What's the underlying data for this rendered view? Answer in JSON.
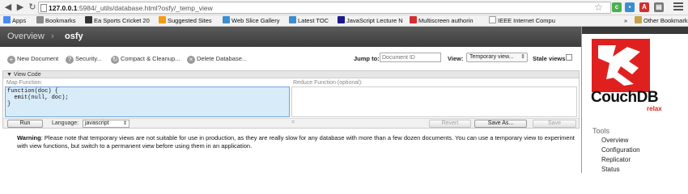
{
  "browser": {
    "url_host": "127.0.0.1",
    "url_rest": ":5984/_utils/database.html?osfy/_temp_view",
    "bookmarks": [
      {
        "label": "Apps",
        "color": "#4a8af4"
      },
      {
        "label": "Bookmarks",
        "color": "#888888"
      },
      {
        "label": "Ea Sports Cricket 20",
        "color": "#333333"
      },
      {
        "label": "Suggested Sites",
        "color": "#f39c12"
      },
      {
        "label": "Web Slice Gallery",
        "color": "#3b8ed0"
      },
      {
        "label": "Latest TOC",
        "color": "#3b8ed0"
      },
      {
        "label": "JavaScript Lecture N",
        "color": "#1a1a8c"
      },
      {
        "label": "Multiscreen authorin",
        "color": "#d32f2f"
      },
      {
        "label": "IEEE Internet Compu",
        "color": "#9e9e9e"
      }
    ],
    "more": "»",
    "other_bookmarks": "Other Bookmarks"
  },
  "header": {
    "crumbs": [
      "Overview",
      "osfy"
    ],
    "separator": "›"
  },
  "toolbar": {
    "new_document": "New Document",
    "security": "Security...",
    "compact": "Compact & Cleanup...",
    "delete_db": "Delete Database...",
    "jump_label": "Jump to:",
    "jump_placeholder": "Document ID",
    "view_label": "View:",
    "view_value": "Temporary view...",
    "stale_label": "Stale views"
  },
  "view_code": {
    "heading": "▼ View Code",
    "map_label": "Map Function:",
    "map_code": "function(doc) {\n  emit(null, doc);\n}",
    "reduce_label": "Reduce Function (optional):",
    "run": "Run",
    "language_label": "Language:",
    "language_value": "javascript",
    "grip": "=",
    "revert": "Revert",
    "save_as": "Save As...",
    "save": "Save"
  },
  "warning": {
    "lead": "Warning",
    "text": ": Please note that temporary views are not suitable for use in production, as they are really slow for any database with more than a few dozen documents. You can use a temporary view to experiment with view functions, but switch to a permanent view before using them in an application."
  },
  "sidebar": {
    "logo_word": "CouchDB",
    "logo_tag": "relax",
    "tools_heading": "Tools",
    "tools": [
      "Overview",
      "Configuration",
      "Replicator",
      "Status"
    ]
  },
  "colors": {
    "couch_red": "#e0201f",
    "header_dark": "#4a4a4a",
    "editor_blue": "#d8ebf9"
  }
}
